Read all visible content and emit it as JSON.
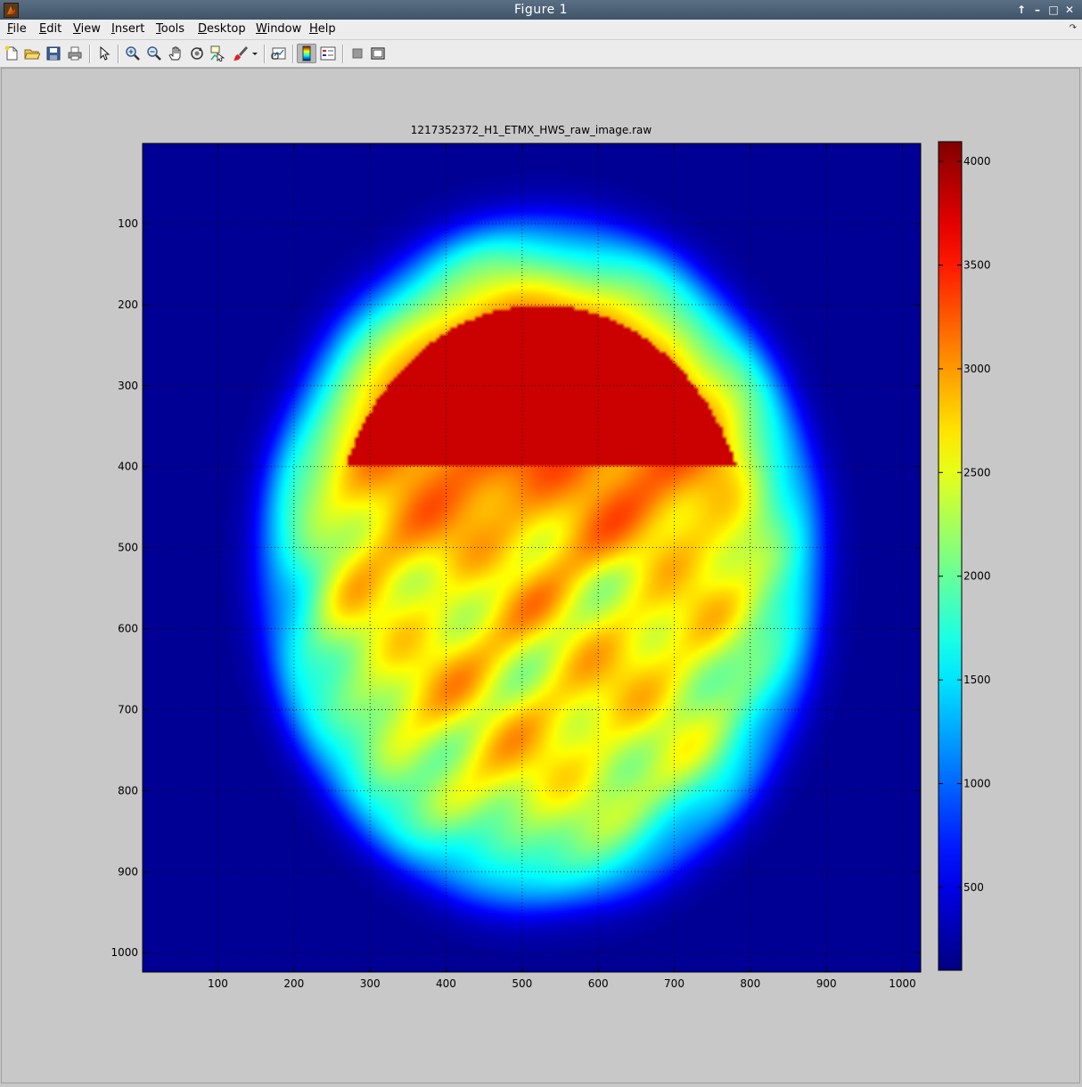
{
  "window": {
    "title": "Figure 1",
    "controls": [
      "↑",
      "–",
      "□",
      "✕"
    ]
  },
  "menu": {
    "items": [
      "File",
      "Edit",
      "View",
      "Insert",
      "Tools",
      "Desktop",
      "Window",
      "Help"
    ]
  },
  "toolbar": {
    "tools": [
      {
        "name": "new-figure-icon"
      },
      {
        "name": "open-file-icon"
      },
      {
        "name": "save-icon"
      },
      {
        "name": "print-icon"
      },
      {
        "name": "edit-plot-arrow-icon"
      },
      {
        "name": "zoom-in-icon"
      },
      {
        "name": "zoom-out-icon"
      },
      {
        "name": "pan-hand-icon"
      },
      {
        "name": "rotate-3d-icon"
      },
      {
        "name": "data-cursor-icon"
      },
      {
        "name": "brush-icon"
      },
      {
        "name": "brush-dropdown-icon"
      },
      {
        "name": "link-plot-icon"
      },
      {
        "name": "insert-colorbar-icon"
      },
      {
        "name": "insert-legend-icon"
      },
      {
        "name": "hide-plot-tools-icon"
      },
      {
        "name": "show-plot-tools-icon"
      }
    ]
  },
  "chart_data": {
    "type": "heatmap",
    "title": "1217352372_H1_ETMX_HWS_raw_image.raw",
    "colormap": "jet",
    "xlim": [
      1,
      1024
    ],
    "ylim": [
      1,
      1024
    ],
    "y_reversed": true,
    "x_ticks": [
      100,
      200,
      300,
      400,
      500,
      600,
      700,
      800,
      900,
      1000
    ],
    "y_ticks": [
      100,
      200,
      300,
      400,
      500,
      600,
      700,
      800,
      900,
      1000
    ],
    "grid": true,
    "colorbar": {
      "range": [
        100,
        4095
      ],
      "ticks": [
        500,
        1000,
        1500,
        2000,
        2500,
        3000,
        3500,
        4000
      ]
    },
    "background_level": 180,
    "beam": {
      "center_x": 525,
      "center_y": 520,
      "radius_x": 375,
      "radius_y": 432,
      "rim_level": 1450,
      "upper_region_level": 4050
    }
  }
}
